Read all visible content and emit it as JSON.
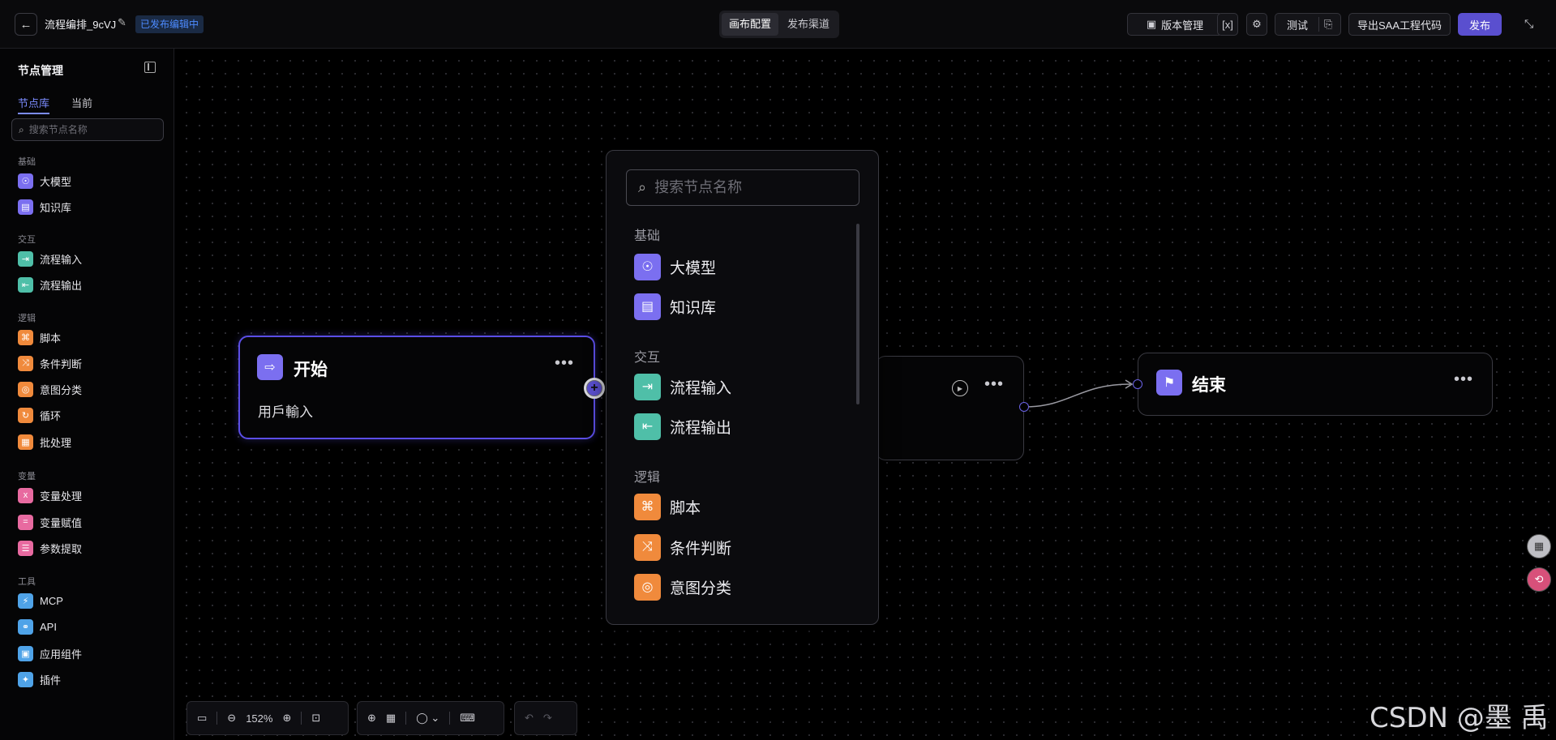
{
  "header": {
    "back_icon": "arrow-left",
    "title": "流程编排_9cVJ",
    "status": "已发布编辑中",
    "segment": [
      "画布配置",
      "发布渠道"
    ],
    "version_btn": "版本管理",
    "test_btn": "测试",
    "export_btn": "导出SAA工程代码",
    "publish_btn": "发布",
    "accent": "#5a4fcf"
  },
  "sidebar": {
    "title": "节点管理",
    "tabs": [
      "节点库",
      "当前"
    ],
    "search_placeholder": "搜索节点名称",
    "groups": [
      {
        "label": "基础",
        "items": [
          {
            "label": "大模型",
            "color": "#7b6ff0",
            "glyph": "☉"
          },
          {
            "label": "知识库",
            "color": "#7b6ff0",
            "glyph": "▤"
          }
        ]
      },
      {
        "label": "交互",
        "items": [
          {
            "label": "流程输入",
            "color": "#4fbfa8",
            "glyph": "⇥"
          },
          {
            "label": "流程输出",
            "color": "#4fbfa8",
            "glyph": "⇤"
          }
        ]
      },
      {
        "label": "逻辑",
        "items": [
          {
            "label": "脚本",
            "color": "#f08a3c",
            "glyph": "⌘"
          },
          {
            "label": "条件判断",
            "color": "#f08a3c",
            "glyph": "⤨"
          },
          {
            "label": "意图分类",
            "color": "#f08a3c",
            "glyph": "◎"
          },
          {
            "label": "循环",
            "color": "#f08a3c",
            "glyph": "↻"
          },
          {
            "label": "批处理",
            "color": "#f08a3c",
            "glyph": "▦"
          }
        ]
      },
      {
        "label": "变量",
        "items": [
          {
            "label": "变量处理",
            "color": "#e86aa0",
            "glyph": "x"
          },
          {
            "label": "变量赋值",
            "color": "#e86aa0",
            "glyph": "="
          },
          {
            "label": "参数提取",
            "color": "#e86aa0",
            "glyph": "☰"
          }
        ]
      },
      {
        "label": "工具",
        "items": [
          {
            "label": "MCP",
            "color": "#4fa3e8",
            "glyph": "⚡"
          },
          {
            "label": "API",
            "color": "#4fa3e8",
            "glyph": "⚭"
          },
          {
            "label": "应用组件",
            "color": "#4fa3e8",
            "glyph": "▣"
          },
          {
            "label": "插件",
            "color": "#4fa3e8",
            "glyph": "✦"
          }
        ]
      }
    ]
  },
  "nodes": {
    "start": {
      "title": "开始",
      "body": "用戶輸入"
    },
    "end": {
      "title": "结束"
    }
  },
  "popup": {
    "search_placeholder": "搜索节点名称",
    "groups": [
      {
        "label": "基础",
        "items": [
          {
            "label": "大模型",
            "color": "#7b6ff0",
            "glyph": "☉"
          },
          {
            "label": "知识库",
            "color": "#7b6ff0",
            "glyph": "▤"
          }
        ]
      },
      {
        "label": "交互",
        "items": [
          {
            "label": "流程输入",
            "color": "#4fbfa8",
            "glyph": "⇥"
          },
          {
            "label": "流程输出",
            "color": "#4fbfa8",
            "glyph": "⇤"
          }
        ]
      },
      {
        "label": "逻辑",
        "items": [
          {
            "label": "脚本",
            "color": "#f08a3c",
            "glyph": "⌘"
          },
          {
            "label": "条件判断",
            "color": "#f08a3c",
            "glyph": "⤨"
          },
          {
            "label": "意图分类",
            "color": "#f08a3c",
            "glyph": "◎"
          }
        ]
      }
    ]
  },
  "bottombar": {
    "zoom": "152%"
  },
  "watermark": "CSDN @墨 禹"
}
